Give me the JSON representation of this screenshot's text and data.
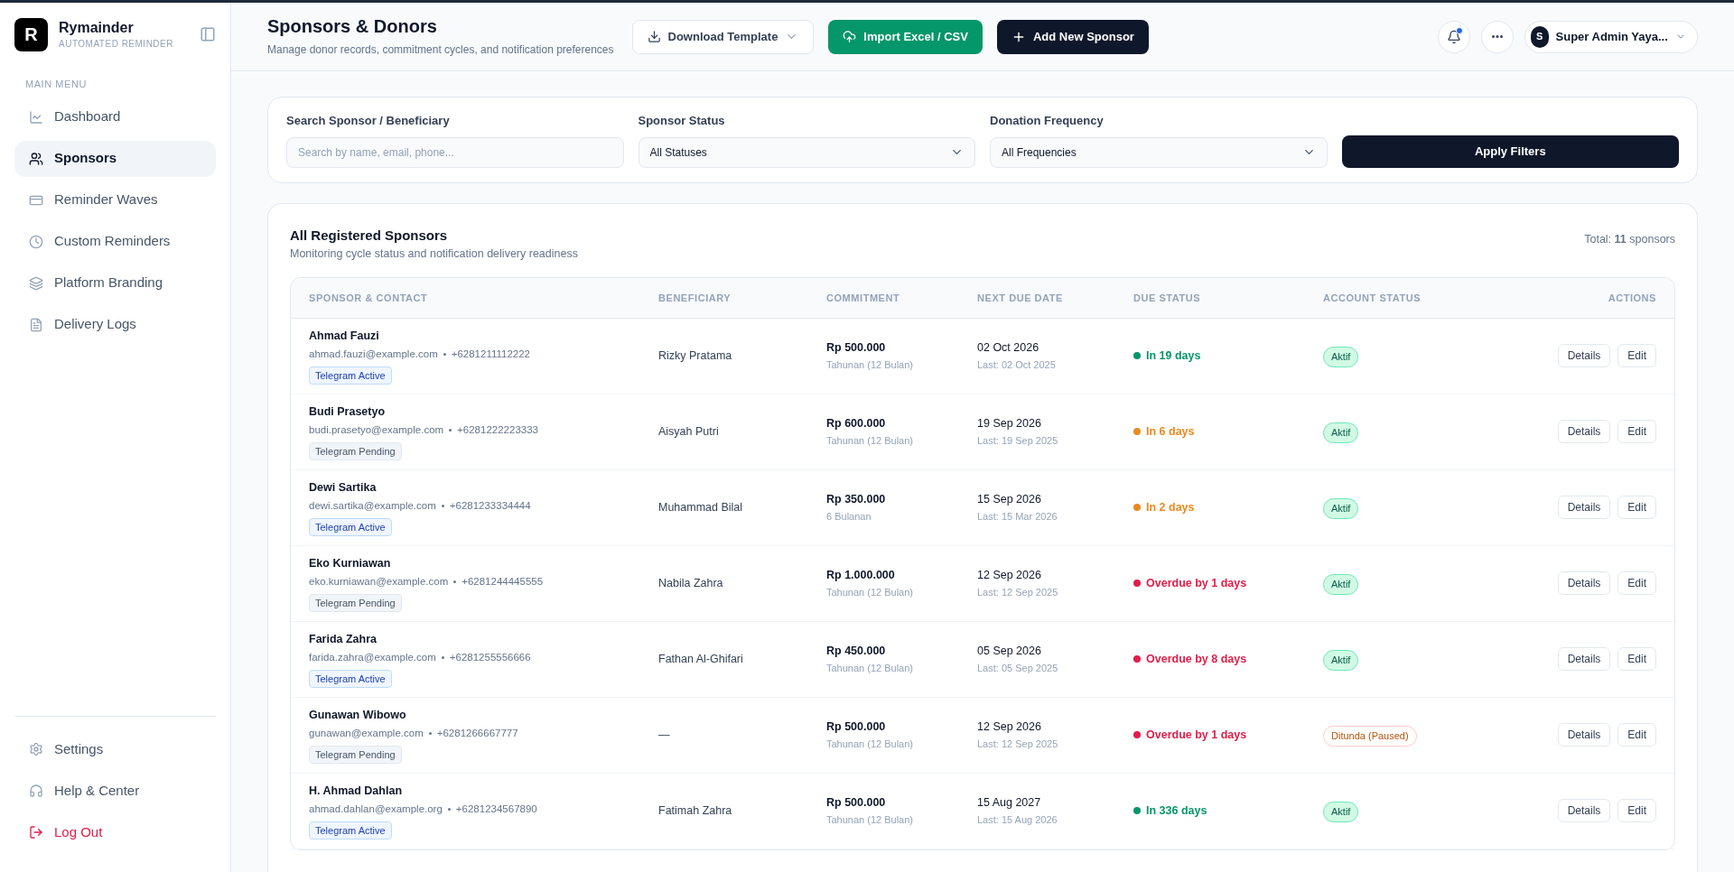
{
  "brand": {
    "logo": "R",
    "name": "Rymainder",
    "tagline": "AUTOMATED REMINDER"
  },
  "sidebar": {
    "section": "MAIN MENU",
    "items": [
      {
        "label": "Dashboard",
        "selected": false
      },
      {
        "label": "Sponsors",
        "selected": true
      },
      {
        "label": "Reminder Waves",
        "selected": false
      },
      {
        "label": "Custom Reminders",
        "selected": false
      },
      {
        "label": "Platform Branding",
        "selected": false
      },
      {
        "label": "Delivery Logs",
        "selected": false
      }
    ],
    "footer": [
      {
        "label": "Settings",
        "kind": "normal"
      },
      {
        "label": "Help & Center",
        "kind": "normal"
      },
      {
        "label": "Log Out",
        "kind": "danger"
      }
    ]
  },
  "header": {
    "title": "Sponsors & Donors",
    "subtitle": "Manage donor records, commitment cycles, and notification preferences",
    "buttons": [
      {
        "label": "Download Template",
        "kind": "outline"
      },
      {
        "label": "Import Excel / CSV",
        "kind": "green"
      },
      {
        "label": "Add New Sponsor",
        "kind": "dark"
      }
    ],
    "notification_unread": true,
    "user": {
      "initial": "S",
      "name": "Super Admin Yaya..."
    }
  },
  "filters": {
    "search": {
      "label": "Search Sponsor / Beneficiary",
      "placeholder": "Search by name, email, phone..."
    },
    "status": {
      "label": "Sponsor Status",
      "value": "All Statuses"
    },
    "frequency": {
      "label": "Donation Frequency",
      "value": "All Frequencies"
    },
    "apply": "Apply Filters"
  },
  "table": {
    "title": "All Registered Sponsors",
    "subtitle": "Monitoring cycle status and notification delivery readiness",
    "total": "Total: **11** sponsors",
    "columns": [
      "SPONSOR & CONTACT",
      "BENEFICIARY",
      "COMMITMENT",
      "NEXT DUE DATE",
      "DUE STATUS",
      "ACCOUNT STATUS",
      "ACTIONS"
    ],
    "rows": [
      {
        "name": "Ahmad Fauzi",
        "email": "ahmad.fauzi@example.com",
        "phone": "+6281211112222",
        "telegram": {
          "label": "Telegram Active",
          "kind": "active"
        },
        "beneficiary": "Rizky Pratama",
        "amount": "Rp 500.000",
        "cycle": "Tahunan (12 Bulan)",
        "due": "02 Oct 2026",
        "last": "Last: 02 Oct 2025",
        "due_status": "In 19 days",
        "color": "#059669",
        "account": {
          "label": "Aktif",
          "kind": "active"
        },
        "actions": [
          "Details",
          "Edit"
        ]
      },
      {
        "name": "Budi Prasetyo",
        "email": "budi.prasetyo@example.com",
        "phone": "+6281222223333",
        "telegram": {
          "label": "Telegram Pending",
          "kind": "pending"
        },
        "beneficiary": "Aisyah Putri",
        "amount": "Rp 600.000",
        "cycle": "Tahunan (12 Bulan)",
        "due": "19 Sep 2026",
        "last": "Last: 19 Sep 2025",
        "due_status": "In 6 days",
        "color": "#ea8a1f",
        "account": {
          "label": "Aktif",
          "kind": "active"
        },
        "actions": [
          "Details",
          "Edit"
        ]
      },
      {
        "name": "Dewi Sartika",
        "email": "dewi.sartika@example.com",
        "phone": "+6281233334444",
        "telegram": {
          "label": "Telegram Active",
          "kind": "active"
        },
        "beneficiary": "Muhammad Bilal",
        "amount": "Rp 350.000",
        "cycle": "6 Bulanan",
        "due": "15 Sep 2026",
        "last": "Last: 15 Mar 2026",
        "due_status": "In 2 days",
        "color": "#ea8a1f",
        "account": {
          "label": "Aktif",
          "kind": "active"
        },
        "actions": [
          "Details",
          "Edit"
        ]
      },
      {
        "name": "Eko Kurniawan",
        "email": "eko.kurniawan@example.com",
        "phone": "+6281244445555",
        "telegram": {
          "label": "Telegram Pending",
          "kind": "pending"
        },
        "beneficiary": "Nabila Zahra",
        "amount": "Rp 1.000.000",
        "cycle": "Tahunan (12 Bulan)",
        "due": "12 Sep 2026",
        "last": "Last: 12 Sep 2025",
        "due_status": "Overdue by 1 days",
        "color": "#e11d48",
        "account": {
          "label": "Aktif",
          "kind": "active"
        },
        "actions": [
          "Details",
          "Edit"
        ]
      },
      {
        "name": "Farida Zahra",
        "email": "farida.zahra@example.com",
        "phone": "+6281255556666",
        "telegram": {
          "label": "Telegram Active",
          "kind": "active"
        },
        "beneficiary": "Fathan Al-Ghifari",
        "amount": "Rp 450.000",
        "cycle": "Tahunan (12 Bulan)",
        "due": "05 Sep 2026",
        "last": "Last: 05 Sep 2025",
        "due_status": "Overdue by 8 days",
        "color": "#e11d48",
        "account": {
          "label": "Aktif",
          "kind": "active"
        },
        "actions": [
          "Details",
          "Edit"
        ]
      },
      {
        "name": "Gunawan Wibowo",
        "email": "gunawan@example.com",
        "phone": "+6281266667777",
        "telegram": {
          "label": "Telegram Pending",
          "kind": "pending"
        },
        "beneficiary": "—",
        "amount": "Rp 500.000",
        "cycle": "Tahunan (12 Bulan)",
        "due": "12 Sep 2026",
        "last": "Last: 12 Sep 2025",
        "due_status": "Overdue by 1 days",
        "color": "#e11d48",
        "account": {
          "label": "Ditunda (Paused)",
          "kind": "paused"
        },
        "actions": [
          "Details",
          "Edit"
        ]
      },
      {
        "name": "H. Ahmad Dahlan",
        "email": "ahmad.dahlan@example.org",
        "phone": "+6281234567890",
        "telegram": {
          "label": "Telegram Active",
          "kind": "active"
        },
        "beneficiary": "Fatimah Zahra",
        "amount": "Rp 500.000",
        "cycle": "Tahunan (12 Bulan)",
        "due": "15 Aug 2027",
        "last": "Last: 15 Aug 2026",
        "due_status": "In 336 days",
        "color": "#059669",
        "account": {
          "label": "Aktif",
          "kind": "active"
        },
        "actions": [
          "Details",
          "Edit"
        ]
      }
    ]
  }
}
